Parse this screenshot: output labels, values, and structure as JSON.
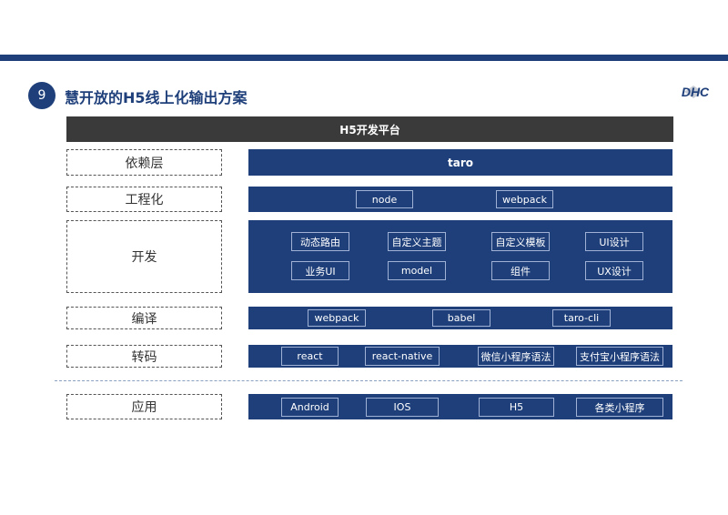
{
  "header": {
    "number": "9",
    "title": "慧开放的H5线上化输出方案",
    "logo_text": "DHC"
  },
  "platform": {
    "label": "H5开发平台"
  },
  "layers": [
    {
      "label": "依赖层",
      "items": [],
      "main_label": "taro"
    },
    {
      "label": "工程化",
      "items": [
        "node",
        "webpack"
      ]
    },
    {
      "label": "开发",
      "items": [
        "动态路由",
        "自定义主题",
        "自定义模板",
        "UI设计",
        "业务UI",
        "model",
        "组件",
        "UX设计"
      ]
    },
    {
      "label": "编译",
      "items": [
        "webpack",
        "babel",
        "taro-cli"
      ]
    },
    {
      "label": "转码",
      "items": [
        "react",
        "react-native",
        "微信小程序语法",
        "支付宝小程序语法"
      ]
    },
    {
      "label": "应用",
      "items": [
        "Android",
        "IOS",
        "H5",
        "各类小程序"
      ]
    }
  ],
  "colors": {
    "primary": "#1e3f7a",
    "platform_bg": "#3a3a3a"
  }
}
